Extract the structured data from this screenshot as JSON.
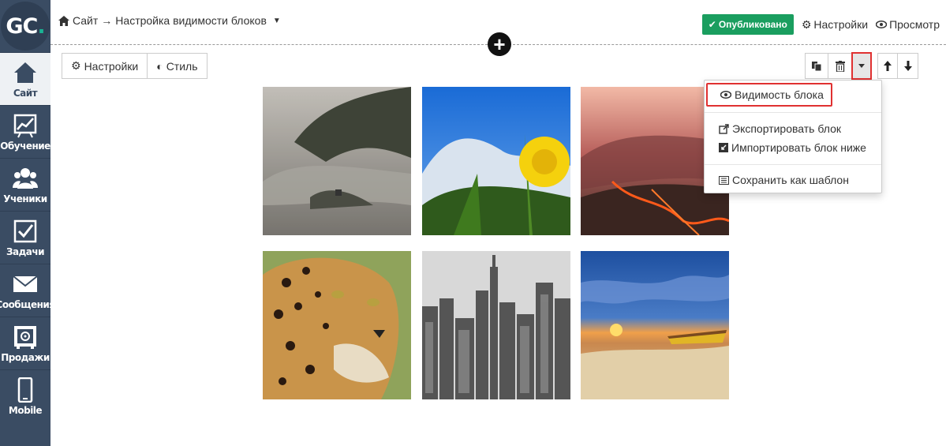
{
  "logo": {
    "text_main": "GC",
    "text_dot": "."
  },
  "sidebar": {
    "items": [
      {
        "label": "Сайт",
        "icon": "home-icon",
        "active": true
      },
      {
        "label": "Обучение",
        "icon": "chart-icon"
      },
      {
        "label": "Ученики",
        "icon": "users-icon"
      },
      {
        "label": "Задачи",
        "icon": "checkbox-icon"
      },
      {
        "label": "Сообщения",
        "icon": "envelope-icon"
      },
      {
        "label": "Продажи",
        "icon": "safe-icon"
      },
      {
        "label": "Mobile",
        "icon": "phone-icon"
      }
    ]
  },
  "breadcrumb": {
    "site": "Сайт",
    "arrow": "→",
    "page": "Настройка видимости блоков"
  },
  "header": {
    "published_label": "Опубликовано",
    "settings_label": "Настройки",
    "preview_label": "Просмотр"
  },
  "block_toolbar": {
    "settings_label": "Настройки",
    "style_label": "Стиль"
  },
  "dropdown": {
    "visibility_label": "Видимость блока",
    "export_label": "Экспортировать блок",
    "import_label": "Импортировать блок ниже",
    "save_template_label": "Сохранить как шаблон"
  },
  "gallery": {
    "photos": [
      {
        "subject": "misty-mountains"
      },
      {
        "subject": "dandelion-sky"
      },
      {
        "subject": "volcanic-landscape"
      },
      {
        "subject": "leopard"
      },
      {
        "subject": "city-skyline"
      },
      {
        "subject": "beach-sunset"
      }
    ]
  },
  "colors": {
    "sidebar": "#3a4c63",
    "accent": "#1ab394",
    "published": "#1a9e5f",
    "highlight": "#e03131"
  }
}
